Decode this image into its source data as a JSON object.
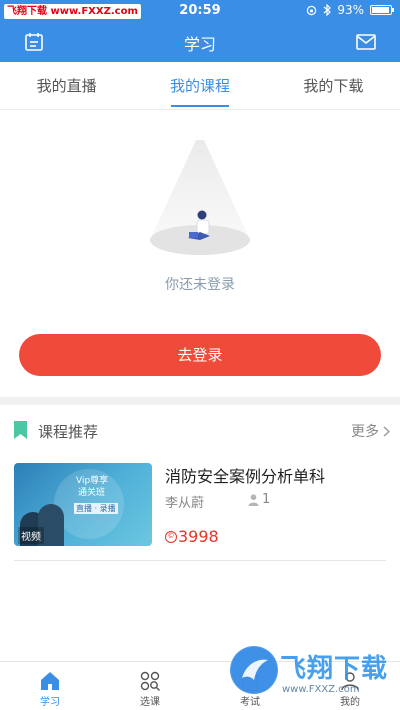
{
  "status_bar": {
    "watermark": "飞翔下载 www.FXXZ.com",
    "time": "20:59",
    "battery": "93%"
  },
  "nav": {
    "title": "学习",
    "left_icon": "calendar-icon",
    "right_icon": "mail-icon"
  },
  "tabs": [
    {
      "label": "我的直播",
      "active": false
    },
    {
      "label": "我的课程",
      "active": true
    },
    {
      "label": "我的下载",
      "active": false
    }
  ],
  "empty_state": {
    "message": "你还未登录",
    "login_button": "去登录"
  },
  "recommend": {
    "title": "课程推荐",
    "more": "更多",
    "courses": [
      {
        "name": "消防安全案例分析单科",
        "teacher": "李从蔚",
        "students": "1",
        "price_symbol": "©",
        "price": "3998",
        "thumb_line1": "Vip尊享",
        "thumb_line2": "通关班",
        "thumb_line3": "直播 · 录播",
        "thumb_tag": "视频"
      }
    ]
  },
  "bottom_tabs": [
    {
      "label": "学习",
      "icon": "home-icon",
      "active": true
    },
    {
      "label": "选课",
      "icon": "grid-search-icon",
      "active": false
    },
    {
      "label": "考试",
      "icon": "exam-icon",
      "active": false
    },
    {
      "label": "我的",
      "icon": "user-icon",
      "active": false
    }
  ],
  "watermark_bottom": {
    "name": "飞翔下载",
    "url": "www.FXXZ.com"
  },
  "colors": {
    "brand": "#3a8ee6",
    "button": "#f04a3a",
    "price": "#e8322b"
  }
}
